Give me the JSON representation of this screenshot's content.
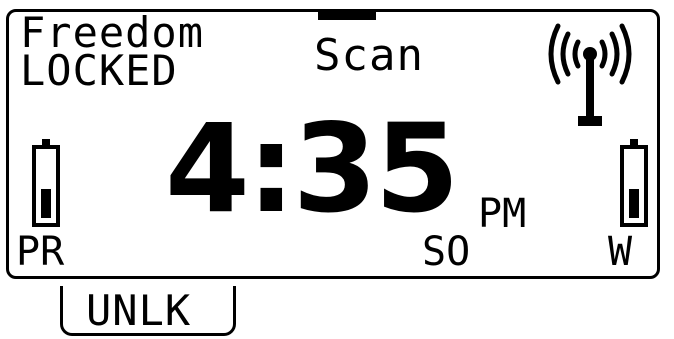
{
  "header": {
    "title": "Freedom",
    "lock_status": "LOCKED",
    "mode": "Scan"
  },
  "clock": {
    "time": "4:35",
    "period": "PM"
  },
  "indicators": {
    "left_label": "PR",
    "center_label": "SO",
    "right_label": "W",
    "left_battery_level": 0.45,
    "right_battery_level": 0.45
  },
  "softkey": {
    "label": "UNLK"
  },
  "icons": {
    "signal": "antenna-signal-icon"
  },
  "colors": {
    "foreground": "#000000",
    "background": "#ffffff"
  }
}
